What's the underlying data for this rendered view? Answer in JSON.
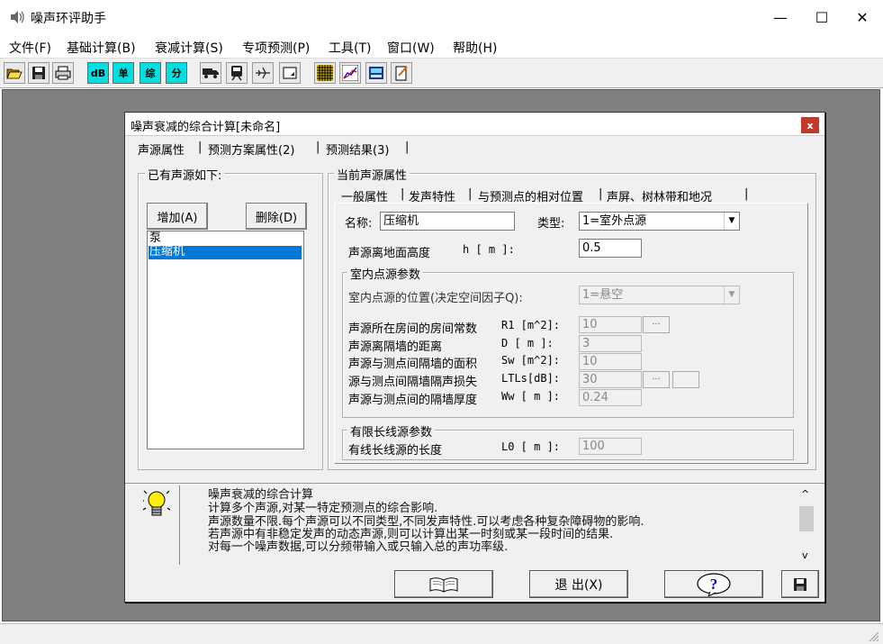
{
  "app": {
    "title": "噪声环评助手",
    "icon": "speaker-icon"
  },
  "window_controls": {
    "minimize": "—",
    "maximize": "☐",
    "close": "✕"
  },
  "menu": [
    "文件(F)",
    "基础计算(B)",
    "衰减计算(S)",
    "专项预测(P)",
    "工具(T)",
    "窗口(W)",
    "帮助(H)"
  ],
  "toolbar": {
    "buttons": [
      {
        "icon": "open-folder-icon",
        "label": ""
      },
      {
        "icon": "save-disk-icon",
        "label": ""
      },
      {
        "icon": "print-icon",
        "label": ""
      },
      {
        "icon": "db-icon",
        "label": "dB"
      },
      {
        "icon": "single-icon",
        "label": "单"
      },
      {
        "icon": "composite-icon",
        "label": "综"
      },
      {
        "icon": "split-icon",
        "label": "分"
      },
      {
        "icon": "truck-icon",
        "label": ""
      },
      {
        "icon": "train-icon",
        "label": ""
      },
      {
        "icon": "aircraft-icon",
        "label": ""
      },
      {
        "icon": "window-icon",
        "label": ""
      },
      {
        "icon": "grid-icon",
        "label": ""
      },
      {
        "icon": "chart-icon",
        "label": ""
      },
      {
        "icon": "calculator-icon",
        "label": ""
      },
      {
        "icon": "notepad-icon",
        "label": ""
      }
    ]
  },
  "dialog": {
    "title": "噪声衰减的综合计算[未命名]",
    "close": "x",
    "tabs": [
      "声源属性",
      "预测方案属性(2)",
      "预测结果(3)"
    ],
    "tab_sep": "|",
    "sources_group": {
      "label": "已有声源如下:",
      "add_button": "增加(A)",
      "delete_button": "删除(D)",
      "items": [
        "泵",
        "压缩机"
      ],
      "selected_index": 1
    },
    "current_group": {
      "label": "当前声源属性",
      "subtabs": [
        "一般属性",
        "发声特性",
        "与预测点的相对位置",
        "声屏、树林带和地况"
      ],
      "name_label": "名称:",
      "name_value": "压缩机",
      "type_label": "类型:",
      "type_value": "1=室外点源",
      "height_label": "声源离地面高度",
      "height_unit": "h [ m ]:",
      "height_value": "0.5",
      "indoor": {
        "label": "室内点源参数",
        "position_label": "室内点源的位置(决定空间因子Q):",
        "position_value": "1=悬空",
        "rows": [
          {
            "label": "声源所在房间的房间常数",
            "unit": "R1 [m^2]:",
            "value": "10",
            "button": "···"
          },
          {
            "label": "声源离隔墙的距离",
            "unit": "D  [ m ]:",
            "value": "3"
          },
          {
            "label": "声源与测点间隔墙的面积",
            "unit": "Sw [m^2]:",
            "value": "10"
          },
          {
            "label": "源与测点间隔墙隔声损失",
            "unit": "LTLs[dB]:",
            "value": "30",
            "button": "···"
          },
          {
            "label": "声源与测点间的隔墙厚度",
            "unit": "Ww [ m ]:",
            "value": "0.24"
          }
        ]
      },
      "line": {
        "label": "有限长线源参数",
        "length_label": "有线长线源的长度",
        "length_unit": "L0 [ m ]:",
        "length_value": "100"
      }
    },
    "info": {
      "icon": "lightbulb-icon",
      "lines": [
        "噪声衰减的综合计算",
        "计算多个声源,对某一特定预测点的综合影响.",
        "声源数量不限.每个声源可以不同类型,不同发声特性.可以考虑各种复杂障碍物的影响.",
        "若声源中有非稳定发声的动态声源,则可以计算出某一时刻或某一段时间的结果.",
        "对每一个噪声数据,可以分频带输入或只输入总的声功率级."
      ],
      "scroll_up": "^",
      "scroll_down": "v"
    },
    "bottom_buttons": {
      "book": "book-icon",
      "exit": "退 出(X)",
      "help": "?",
      "save": "save-disk-icon"
    }
  }
}
